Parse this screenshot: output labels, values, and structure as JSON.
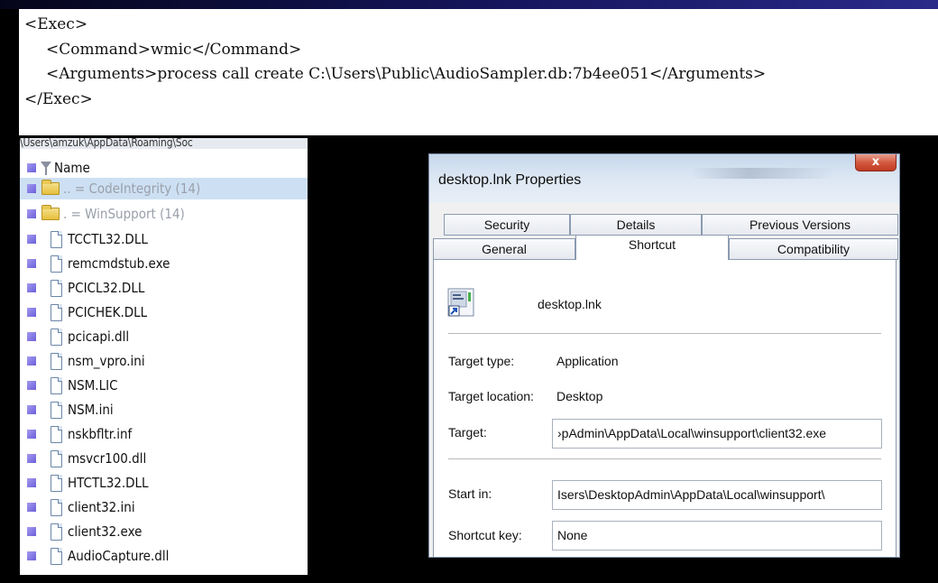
{
  "code": {
    "lines": [
      "<Exec>",
      "<Command>wmic</Command>",
      "<Arguments>process call create C:\\Users\\Public\\AudioSampler.db:7b4ee051</Arguments>",
      "</Exec>"
    ]
  },
  "explorer": {
    "path": "\\Users\\amzuk\\AppData\\Roaming\\Soc",
    "column_header": "Name",
    "rows": [
      {
        "type": "folder",
        "label": "..  =  CodeIntegrity (14)",
        "selected": true
      },
      {
        "type": "folder",
        "label": ".  =  WinSupport (14)",
        "selected": false
      },
      {
        "type": "file",
        "label": "TCCTL32.DLL"
      },
      {
        "type": "file",
        "label": "remcmdstub.exe"
      },
      {
        "type": "file",
        "label": "PCICL32.DLL"
      },
      {
        "type": "file",
        "label": "PCICHEK.DLL"
      },
      {
        "type": "file",
        "label": "pcicapi.dll"
      },
      {
        "type": "file",
        "label": "nsm_vpro.ini"
      },
      {
        "type": "file",
        "label": "NSM.LIC"
      },
      {
        "type": "file",
        "label": "NSM.ini"
      },
      {
        "type": "file",
        "label": "nskbfltr.inf"
      },
      {
        "type": "file",
        "label": "msvcr100.dll"
      },
      {
        "type": "file",
        "label": "HTCTL32.DLL"
      },
      {
        "type": "file",
        "label": "client32.ini"
      },
      {
        "type": "file",
        "label": "client32.exe"
      },
      {
        "type": "file",
        "label": "AudioCapture.dll"
      }
    ]
  },
  "dialog": {
    "title": "desktop.lnk Properties",
    "close_label": "x",
    "tabs_back": [
      "Security",
      "Details",
      "Previous Versions"
    ],
    "tabs_front": [
      "General",
      "Shortcut",
      "Compatibility"
    ],
    "active_tab": "Shortcut",
    "shortcut_name": "desktop.lnk",
    "fields": {
      "target_type_label": "Target type:",
      "target_type_value": "Application",
      "target_location_label": "Target location:",
      "target_location_value": "Desktop",
      "target_label": "Target:",
      "target_value": "›pAdmin\\AppData\\Local\\winsupport\\client32.exe",
      "start_in_label": "Start in:",
      "start_in_value": "Isers\\DesktopAdmin\\AppData\\Local\\winsupport\\",
      "shortcut_key_label": "Shortcut key:",
      "shortcut_key_value": "None"
    }
  },
  "colors": {
    "background": "#000000",
    "selection": "#cde0f3",
    "bullet": "#6b5fd8",
    "close_button": "#d35a40"
  }
}
